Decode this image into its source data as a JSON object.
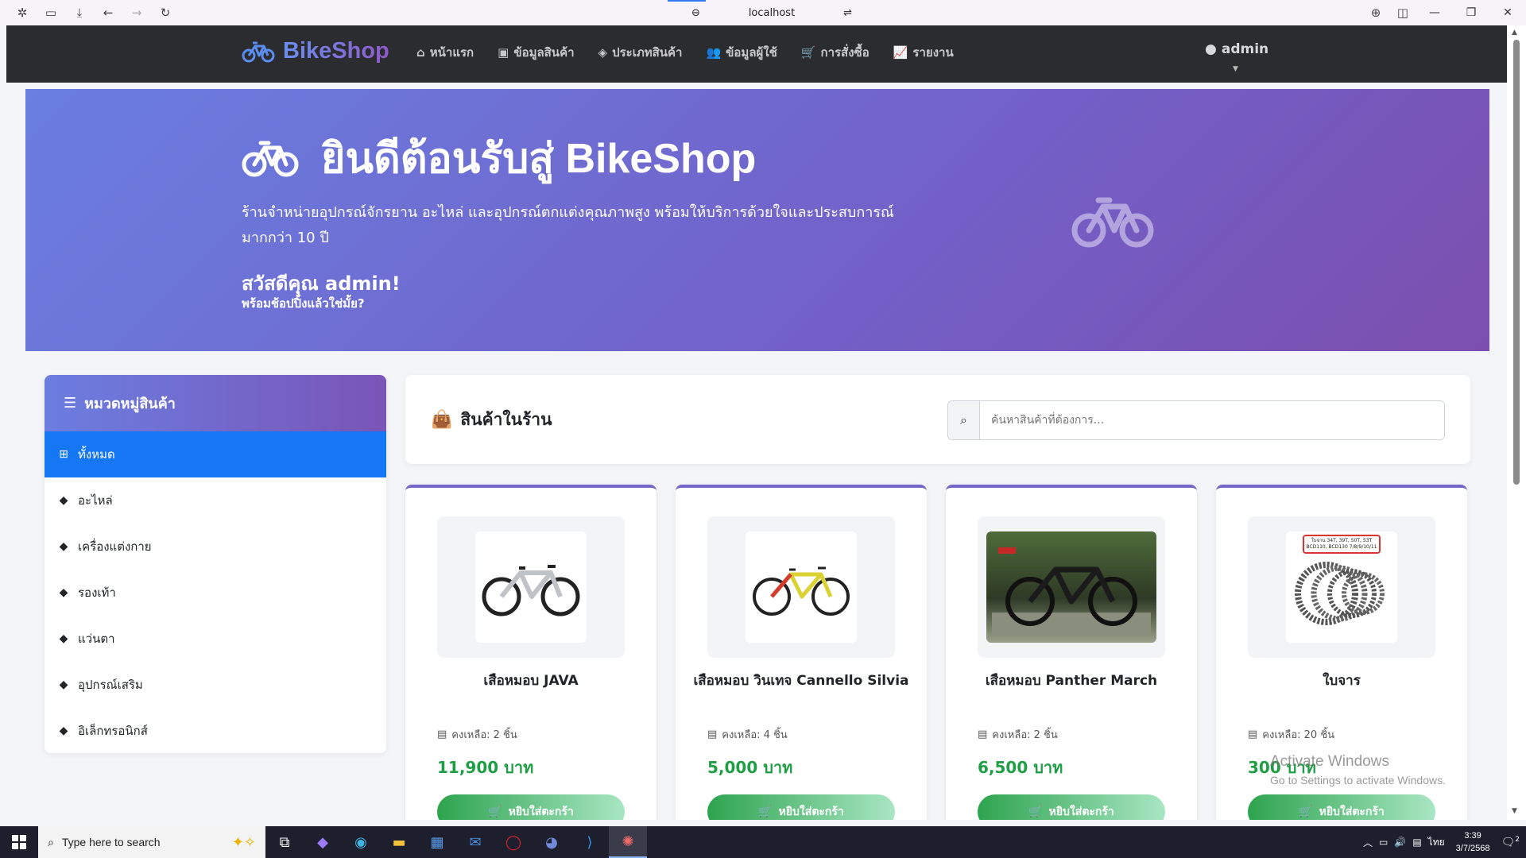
{
  "browser": {
    "url": "localhost"
  },
  "navbar": {
    "brand": "BikeShop",
    "items": [
      {
        "label": "หน้าแรก",
        "icon": "home-icon"
      },
      {
        "label": "ข้อมูลสินค้า",
        "icon": "box-icon"
      },
      {
        "label": "ประเภทสินค้า",
        "icon": "tag-icon"
      },
      {
        "label": "ข้อมูลผู้ใช้",
        "icon": "users-icon"
      },
      {
        "label": "การสั่งซื้อ",
        "icon": "cart-icon"
      },
      {
        "label": "รายงาน",
        "icon": "chart-icon"
      }
    ],
    "user": "admin"
  },
  "hero": {
    "title": "ยินดีต้อนรับสู่ BikeShop",
    "description": "ร้านจำหน่ายอุปกรณ์จักรยาน อะไหล่ และอุปกรณ์ตกแต่งคุณภาพสูง พร้อมให้บริการด้วยใจและประสบการณ์มากกว่า 10 ปี",
    "greeting": "สวัสดีคุณ admin!",
    "subgreeting": "พร้อมช้อปปิ้งแล้วใช่มั้ย?"
  },
  "sidebar": {
    "title": "หมวดหมู่สินค้า",
    "items": [
      {
        "label": "ทั้งหมด",
        "active": true
      },
      {
        "label": "อะไหล่"
      },
      {
        "label": "เครื่องแต่งกาย"
      },
      {
        "label": "รองเท้า"
      },
      {
        "label": "แว่นตา"
      },
      {
        "label": "อุปกรณ์เสริม"
      },
      {
        "label": "อิเล็กทรอนิกส์"
      }
    ]
  },
  "products": {
    "title": "สินค้าในร้าน",
    "search_placeholder": "ค้นหาสินค้าที่ต้องการ...",
    "add_label": "หยิบใส่ตะกร้า",
    "items": [
      {
        "name": "เสือหมอบ JAVA",
        "stock": "คงเหลือ: 2 ชิ้น",
        "price": "11,900 บาท"
      },
      {
        "name": "เสือหมอบ วินเทจ Cannello Silvia",
        "stock": "คงเหลือ: 4 ชิ้น",
        "price": "5,000 บาท"
      },
      {
        "name": "เสือหมอบ Panther March",
        "stock": "คงเหลือ: 2 ชิ้น",
        "price": "6,500 บาท"
      },
      {
        "name": "ใบจาร",
        "stock": "คงเหลือ: 20 ชิ้น",
        "price": "300 บาท"
      }
    ],
    "chainring_label": "ใบจาน 34T, 39T, 50T, 53T BCD110, BCD130 7/8/9/10/11"
  },
  "watermark": {
    "line1": "Activate Windows",
    "line2": "Go to Settings to activate Windows."
  },
  "taskbar": {
    "search_placeholder": "Type here to search",
    "lang": "ไทย",
    "time": "3:39",
    "date": "3/7/2568",
    "notifications": "2"
  }
}
